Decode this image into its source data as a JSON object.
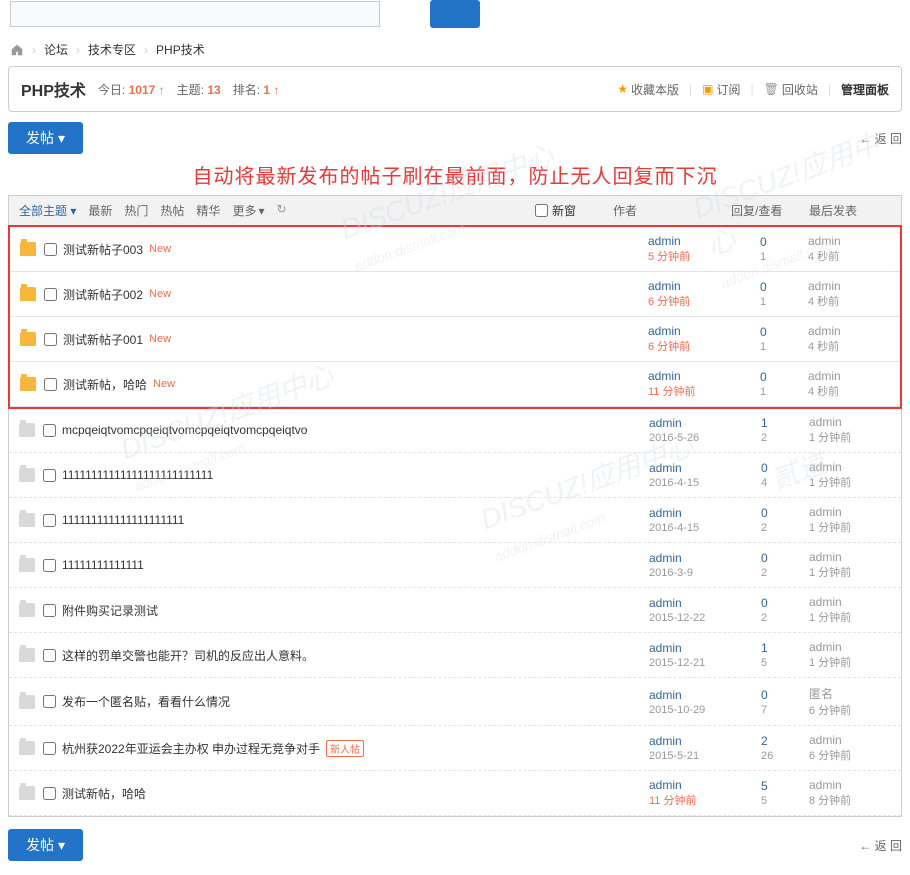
{
  "breadcrumb": {
    "home": "论坛",
    "section": "技术专区",
    "board": "PHP技术"
  },
  "forum": {
    "title": "PHP技术",
    "today_label": "今日:",
    "today_count": "1017",
    "topics_label": "主题:",
    "topics_count": "13",
    "rank_label": "排名:",
    "rank_value": "1"
  },
  "tools": {
    "fav": "收藏本版",
    "rss": "订阅",
    "recycle": "回收站",
    "manage": "管理面板"
  },
  "post_btn": "发帖",
  "back": "返 回",
  "red_note": "自动将最新发布的帖子刷在最前面，防止无人回复而下沉",
  "filter": {
    "all": "全部主题",
    "latest": "最新",
    "hot_disc": "热门",
    "hot_post": "热帖",
    "digest": "精华",
    "more": "更多"
  },
  "columns": {
    "newwin": "新窗",
    "author": "作者",
    "reply": "回复/查看",
    "last": "最后发表"
  },
  "threads": [
    {
      "hl": true,
      "folder": "open",
      "title": "测试新帖子003",
      "new": true,
      "badge": false,
      "author": "admin",
      "date": "5 分钟前",
      "date_red": true,
      "replies": "0",
      "views": "1",
      "last_user": "admin",
      "last_date": "4 秒前"
    },
    {
      "hl": true,
      "folder": "open",
      "title": "测试新帖子002",
      "new": true,
      "badge": false,
      "author": "admin",
      "date": "6 分钟前",
      "date_red": true,
      "replies": "0",
      "views": "1",
      "last_user": "admin",
      "last_date": "4 秒前"
    },
    {
      "hl": true,
      "folder": "open",
      "title": "测试新帖子001",
      "new": true,
      "badge": false,
      "author": "admin",
      "date": "6 分钟前",
      "date_red": true,
      "replies": "0",
      "views": "1",
      "last_user": "admin",
      "last_date": "4 秒前"
    },
    {
      "hl": true,
      "folder": "open",
      "title": "测试新帖，哈哈",
      "new": true,
      "badge": false,
      "author": "admin",
      "date": "11 分钟前",
      "date_red": true,
      "replies": "0",
      "views": "1",
      "last_user": "admin",
      "last_date": "4 秒前"
    },
    {
      "hl": false,
      "folder": "closed",
      "title": "mcpqeiqtvomcpqeiqtvomcpqeiqtvomcpqeiqtvo",
      "new": false,
      "badge": false,
      "author": "admin",
      "date": "2016-5-26",
      "date_red": false,
      "replies": "1",
      "views": "2",
      "last_user": "admin",
      "last_date": "1 分钟前"
    },
    {
      "hl": false,
      "folder": "closed",
      "title": "11111111111111111111111111",
      "new": false,
      "badge": false,
      "author": "admin",
      "date": "2016-4-15",
      "date_red": false,
      "replies": "0",
      "views": "4",
      "last_user": "admin",
      "last_date": "1 分钟前"
    },
    {
      "hl": false,
      "folder": "closed",
      "title": "111111111111111111111",
      "new": false,
      "badge": false,
      "author": "admin",
      "date": "2016-4-15",
      "date_red": false,
      "replies": "0",
      "views": "2",
      "last_user": "admin",
      "last_date": "1 分钟前"
    },
    {
      "hl": false,
      "folder": "closed",
      "title": "11111111111111",
      "new": false,
      "badge": false,
      "author": "admin",
      "date": "2016-3-9",
      "date_red": false,
      "replies": "0",
      "views": "2",
      "last_user": "admin",
      "last_date": "1 分钟前"
    },
    {
      "hl": false,
      "folder": "closed",
      "title": "附件购买记录测试",
      "new": false,
      "badge": false,
      "author": "admin",
      "date": "2015-12-22",
      "date_red": false,
      "replies": "0",
      "views": "2",
      "last_user": "admin",
      "last_date": "1 分钟前"
    },
    {
      "hl": false,
      "folder": "closed",
      "title": "这样的罚单交警也能开？司机的反应出人意料。",
      "new": false,
      "badge": false,
      "author": "admin",
      "date": "2015-12-21",
      "date_red": false,
      "replies": "1",
      "views": "5",
      "last_user": "admin",
      "last_date": "1 分钟前"
    },
    {
      "hl": false,
      "folder": "closed",
      "title": "发布一个匿名贴，看看什么情况",
      "new": false,
      "badge": false,
      "author": "admin",
      "date": "2015-10-29",
      "date_red": false,
      "replies": "0",
      "views": "7",
      "last_user": "匿名",
      "last_date": "6 分钟前"
    },
    {
      "hl": false,
      "folder": "closed",
      "title": "杭州获2022年亚运会主办权 申办过程无竞争对手",
      "new": false,
      "badge": true,
      "author": "admin",
      "date": "2015-5-21",
      "date_red": false,
      "replies": "2",
      "views": "26",
      "last_user": "admin",
      "last_date": "6 分钟前"
    },
    {
      "hl": false,
      "folder": "closed",
      "title": "测试新帖，哈哈",
      "new": false,
      "badge": false,
      "author": "admin",
      "date": "11 分钟前",
      "date_red": true,
      "replies": "5",
      "views": "5",
      "last_user": "admin",
      "last_date": "8 分钟前"
    }
  ],
  "new_label": "New",
  "badge_label": "新人帖"
}
